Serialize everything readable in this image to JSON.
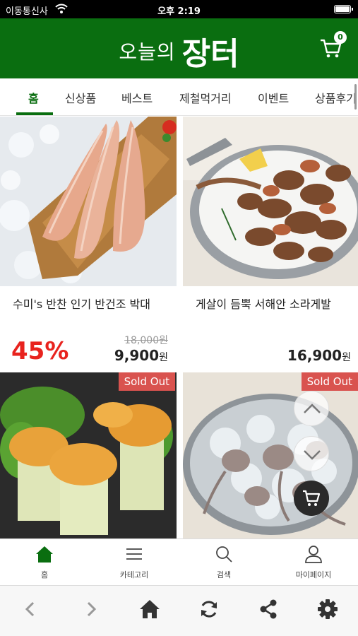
{
  "status_bar": {
    "carrier": "이동통신사",
    "time": "오후 2:19"
  },
  "header": {
    "logo_small": "오늘의",
    "logo_big": "장터",
    "cart_count": "0"
  },
  "tabs": [
    {
      "label": "홈",
      "active": true
    },
    {
      "label": "신상품"
    },
    {
      "label": "베스트"
    },
    {
      "label": "제철먹거리"
    },
    {
      "label": "이벤트"
    },
    {
      "label": "상품후기"
    }
  ],
  "products": [
    {
      "name": "수미's 반찬 인기 반건조 박대",
      "discount": "45%",
      "original_price": "18,000원",
      "price": "9,900",
      "currency": "원"
    },
    {
      "name": "게살이 듬뿍 서해안 소라게발",
      "price": "16,900",
      "currency": "원"
    },
    {
      "sold_out": "Sold Out"
    },
    {
      "sold_out": "Sold Out"
    }
  ],
  "bottom_nav": [
    {
      "label": "홈",
      "icon": "home-icon"
    },
    {
      "label": "카테고리",
      "icon": "menu-icon"
    },
    {
      "label": "검색",
      "icon": "search-icon"
    },
    {
      "label": "마이페이지",
      "icon": "user-icon"
    }
  ],
  "browser_toolbar": [
    "back-icon",
    "forward-icon",
    "home-icon",
    "refresh-icon",
    "share-icon",
    "gear-icon"
  ],
  "colors": {
    "brand": "#0a6e10",
    "discount": "#e8231e",
    "sold_out": "#d9534f"
  }
}
